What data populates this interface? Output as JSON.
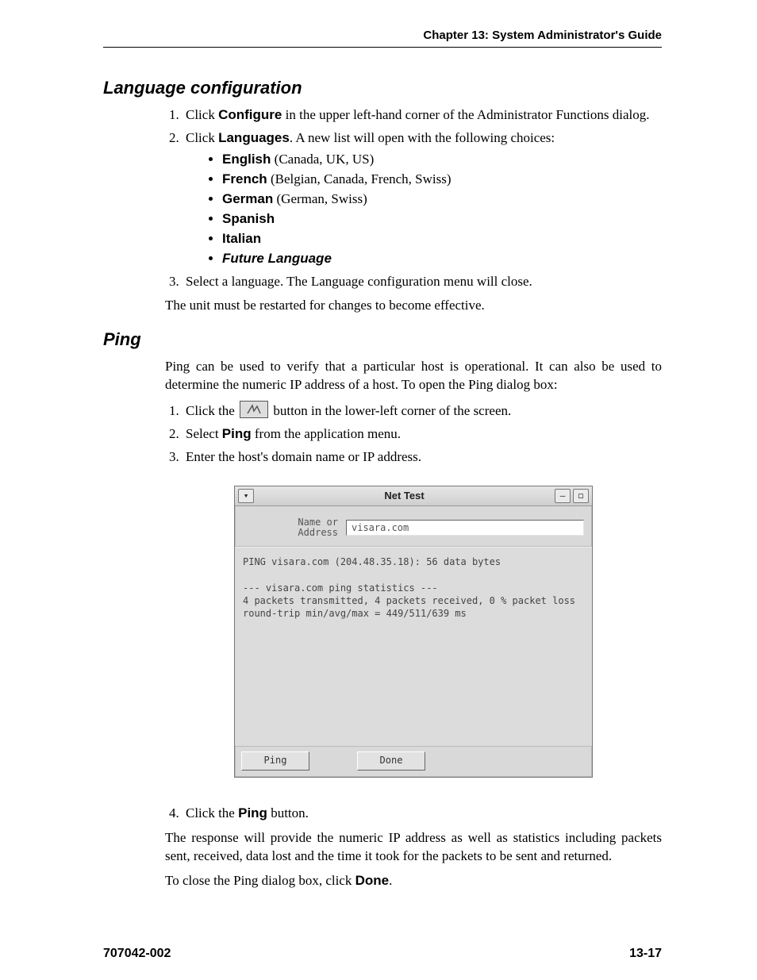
{
  "header": {
    "running": "Chapter 13: System Administrator's Guide"
  },
  "section1": {
    "title": "Language configuration",
    "step1_pre": "Click ",
    "step1_bold": "Configure",
    "step1_post": " in the upper left-hand corner of the Administrator Functions dialog.",
    "step2_pre": "Click ",
    "step2_bold": "Languages",
    "step2_post": ". A new list will open with the following choices:",
    "langs": [
      {
        "name": "English",
        "note": " (Canada, UK, US)"
      },
      {
        "name": "French",
        "note": " (Belgian, Canada, French, Swiss)"
      },
      {
        "name": "German",
        "note": " (German, Swiss)"
      },
      {
        "name": "Spanish",
        "note": ""
      },
      {
        "name": "Italian",
        "note": ""
      },
      {
        "name": "Future Language",
        "note": "",
        "italic": true
      }
    ],
    "step3": "Select a language. The Language configuration menu will close.",
    "para": "The unit must be restarted for changes to become effective."
  },
  "section2": {
    "title": "Ping",
    "intro": "Ping can be used to verify that a particular host is operational. It can also be used to determine the numeric IP address of a host. To open the Ping dialog box:",
    "step1_pre": "Click the ",
    "step1_post": " button in the lower-left corner of the screen.",
    "step2_pre": "Select ",
    "step2_bold": "Ping",
    "step2_post": " from the application menu.",
    "step3": "Enter the host's domain name or IP address."
  },
  "nettest": {
    "title": "Net Test",
    "label_line1": "Name or",
    "label_line2": "Address",
    "input_value": "visara.com",
    "output": "PING visara.com (204.48.35.18): 56 data bytes\n\n--- visara.com ping statistics ---\n4 packets transmitted, 4 packets received, 0 % packet loss\nround-trip min/avg/max = 449/511/639 ms",
    "btn_ping": "Ping",
    "btn_done": "Done"
  },
  "after": {
    "step4_pre": "Click the ",
    "step4_bold": "Ping",
    "step4_post": " button.",
    "para1": "The response will provide the numeric IP address as well as statistics including packets sent, received, data lost and the time it took for the packets to be sent and returned.",
    "para2_pre": "To close the Ping dialog box, click ",
    "para2_bold": "Done",
    "para2_post": "."
  },
  "footer": {
    "left": "707042-002",
    "right": "13-17"
  }
}
